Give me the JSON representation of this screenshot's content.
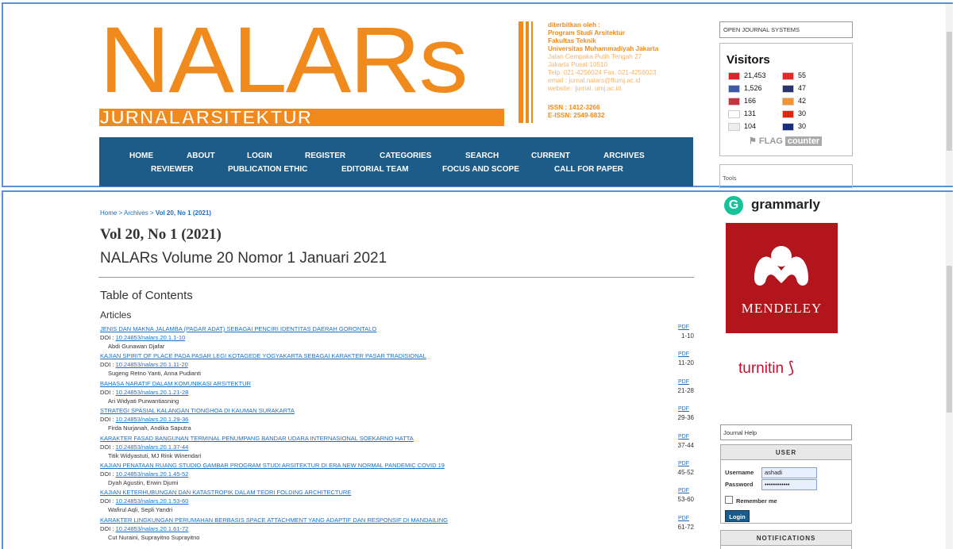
{
  "logo": {
    "title": "NALARs",
    "subtitle": "JURNALARSITEKTUR",
    "colors": {
      "brand": "#f08a1c",
      "nav": "#1d5c89"
    }
  },
  "publisher": {
    "lines": [
      "diterbitkan oleh :",
      "Program Studi Arsitektur",
      "Fakultas Teknik",
      "Universitas Muhammadiyah Jakarta",
      "Jalan Cempaka Putih Tengah 27",
      "Jakarta Pusat 10510",
      "Telp. 021-4256024     Fax. 021-4256023",
      "email : jurnal.nalars@ftumj.ac.id",
      "website : jurnal. umj.ac.id"
    ],
    "issn": "ISSN : 1412-3266",
    "eissn": "E-ISSN: 2549-6832"
  },
  "nav": {
    "row1": [
      "HOME",
      "ABOUT",
      "LOGIN",
      "REGISTER",
      "CATEGORIES",
      "SEARCH",
      "CURRENT",
      "ARCHIVES"
    ],
    "row2": [
      "REVIEWER",
      "PUBLICATION ETHIC",
      "EDITORIAL TEAM",
      "FOCUS AND SCOPE",
      "CALL FOR PAPER"
    ]
  },
  "sidebar": {
    "ojs": "OPEN JOURNAL SYSTEMS",
    "visitors_title": "Visitors",
    "visitors": [
      {
        "count": "21,453",
        "color": "#d9262c",
        "col": 0
      },
      {
        "count": "1,526",
        "color": "#3c5aa6",
        "col": 0
      },
      {
        "count": "166",
        "color": "#cc3340",
        "col": 0
      },
      {
        "count": "131",
        "color": "#ffffff",
        "col": 0
      },
      {
        "count": "104",
        "color": "#eeeeee",
        "col": 0
      },
      {
        "count": "55",
        "color": "#e02b2b",
        "col": 1
      },
      {
        "count": "47",
        "color": "#27346e",
        "col": 1
      },
      {
        "count": "42",
        "color": "#f29433",
        "col": 1
      },
      {
        "count": "30",
        "color": "#de2910",
        "col": 1
      },
      {
        "count": "30",
        "color": "#1a2d7a",
        "col": 1
      }
    ],
    "flagcounter": "FLAG",
    "flagcounter2": "counter",
    "tools": "Tools",
    "grammarly": "grammarly",
    "mendeley": "MENDELEY",
    "turnitin": "turnitin",
    "journal_help": "Journal Help",
    "user": {
      "heading": "USER",
      "username_label": "Username",
      "username_value": "ashadi",
      "password_label": "Password",
      "password_value": "••••••••••••",
      "remember": "Remember me",
      "login": "Login"
    },
    "notifications": "NOTIFICATIONS"
  },
  "breadcrumb": {
    "home": "Home",
    "sep": ">",
    "archives": "Archives",
    "current": "Vol 20, No 1 (2021)"
  },
  "issue": {
    "title": "Vol 20, No 1 (2021)",
    "subtitle": "NALARs Volume 20 Nomor 1 Januari 2021",
    "toc": "Table of Contents",
    "section": "Articles"
  },
  "articles": [
    {
      "title": "JENIS DAN MAKNA JALAMBA (PAGAR ADAT) SEBAGAI PENCIRI IDENTITAS DAERAH GORONTALO",
      "doi_label": "DOI :",
      "doi": "10.24853/nalars.20.1.1-10",
      "authors": "Abdi Gunawan Djafar",
      "pdf": "PDF",
      "pages": "1-10"
    },
    {
      "title": "KAJIAN SPIRIT OF PLACE PADA PASAR LEGI KOTAGEDE YOGYAKARTA SEBAGAI KARAKTER PASAR TRADISIONAL",
      "doi_label": "DOI :",
      "doi": "10.24853/nalars.20.1.11-20",
      "authors": "Sugeng Retno Yanti, Anna Pudianti",
      "pdf": "PDF",
      "pages": "11-20"
    },
    {
      "title": "BAHASA NARATIF DALAM KOMUNIKASI ARSITEKTUR",
      "doi_label": "DOI :",
      "doi": "10.24853/nalars.20.1.21-28",
      "authors": "Ari Widyati Purwantiasning",
      "pdf": "PDF",
      "pages": "21-28"
    },
    {
      "title": "STRATEGI SPASIAL KALANGAN TIONGHOA DI KAUMAN SURAKARTA",
      "doi_label": "DOI :",
      "doi": "10.24853/nalars.20.1.29-36",
      "authors": "Firda Nurjanah, Andika Saputra",
      "pdf": "PDF",
      "pages": "29-36"
    },
    {
      "title": "KARAKTER FASAD BANGUNAN TERMINAL PENUMPANG BANDAR UDARA INTERNASIONAL SOEKARNO HATTA",
      "doi_label": "DOI :",
      "doi": "10.24853/nalars.20.1.37-44",
      "authors": "Titik Widyastuti, MJ Rink Winendari",
      "pdf": "PDF",
      "pages": "37-44"
    },
    {
      "title": "KAJIAN PENATAAN RUANG STUDIO GAMBAR PROGRAM STUDI ARSITEKTUR DI ERA NEW NORMAL PANDEMIC COVID 19",
      "doi_label": "DOI :",
      "doi": "10.24853/nalars.20.1.45-52",
      "authors": "Dyah Agustin, Erwin Djumi",
      "pdf": "PDF",
      "pages": "45-52"
    },
    {
      "title": "KAJIAN KETERHUBUNGAN DAN KATASTROPIK DALAM TEORI FOLDING ARCHITECTURE",
      "doi_label": "DOI :",
      "doi": "10.24853/nalars.20.1.53-60",
      "authors": "Wafirul Aqli, Sepli Yandri",
      "pdf": "PDF",
      "pages": "53-60"
    },
    {
      "title": "KARAKTER LINGKUNGAN PERUMAHAN BERBASIS SPACE ATTACHMENT YANG ADAPTIF DAN RESPONSIF DI MANDAILING",
      "doi_label": "DOI :",
      "doi": "10.24853/nalars.20.1.61-72",
      "authors": "Cut Nuraini, Suprayitno Suprayitno",
      "pdf": "PDF",
      "pages": "61-72"
    }
  ]
}
